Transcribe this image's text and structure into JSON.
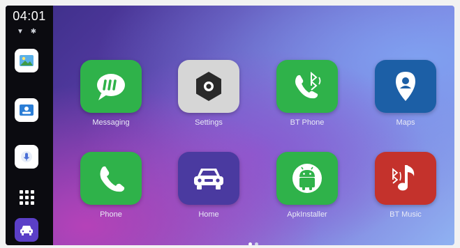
{
  "status_bar": {
    "time": "04:01",
    "wifi_icon": "wifi-icon",
    "bluetooth_icon": "bluetooth-icon"
  },
  "sidebar": {
    "items": [
      {
        "name": "gallery",
        "icon": "image-icon"
      },
      {
        "name": "contacts",
        "icon": "contact-card-icon"
      },
      {
        "name": "assistant",
        "icon": "microphone-icon"
      },
      {
        "name": "app-grid",
        "icon": "app-grid-icon"
      },
      {
        "name": "home",
        "icon": "car-icon"
      }
    ]
  },
  "apps": [
    {
      "label": "Messaging",
      "icon": "message-bubble-icon",
      "color": "#2fb24a"
    },
    {
      "label": "Settings",
      "icon": "settings-hex-icon",
      "color": "#d6d6d6"
    },
    {
      "label": "BT Phone",
      "icon": "bluetooth-phone-icon",
      "color": "#2fb24a"
    },
    {
      "label": "Maps",
      "icon": "map-pin-icon",
      "color": "#1c5fa6"
    },
    {
      "label": "Phone",
      "icon": "phone-icon",
      "color": "#2fb24a"
    },
    {
      "label": "Home",
      "icon": "car-icon",
      "color": "#4a3aa0"
    },
    {
      "label": "ApkInstaller",
      "icon": "android-icon",
      "color": "#2fb24a"
    },
    {
      "label": "BT Music",
      "icon": "bluetooth-music-icon",
      "color": "#c4322c"
    }
  ],
  "pager": {
    "pages": 2,
    "current": 1
  }
}
